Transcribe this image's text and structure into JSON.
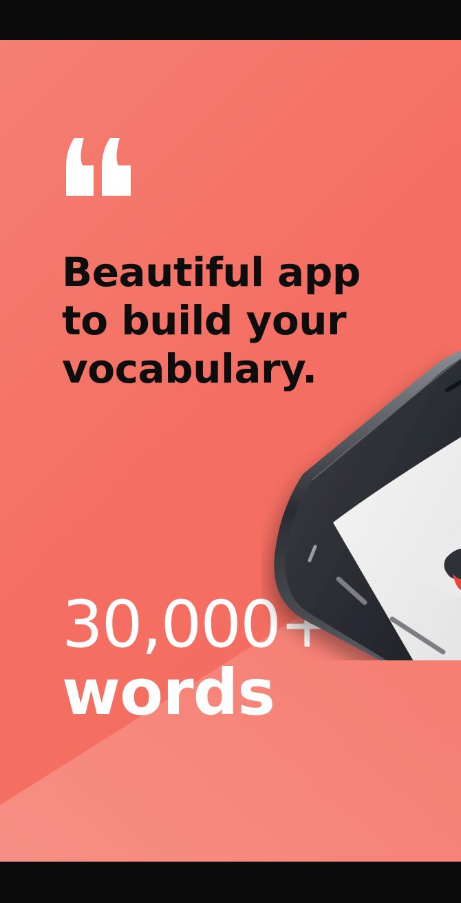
{
  "promo": {
    "headline_lines": [
      "Beautiful app",
      "to build your",
      "vocabulary."
    ],
    "stat_value": "30,000+",
    "stat_unit": "words"
  },
  "icons": {
    "quote": "open-quote-icon",
    "device": "smartphone-mockup"
  },
  "colors": {
    "background": "#f46f63",
    "background_light": "#f7877b",
    "headline_text": "#0d0d0d",
    "stat_text": "#ffffff",
    "quote_mark": "#ffffff",
    "phone_frame": "#2b2d33",
    "screen_accent": "#e8473f",
    "letterbox": "#0b0b0b"
  }
}
